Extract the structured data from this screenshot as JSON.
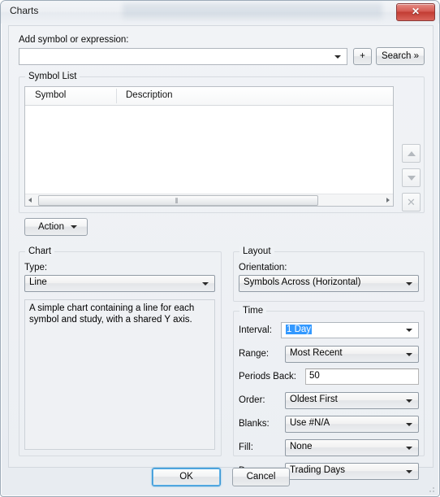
{
  "window": {
    "title": "Charts",
    "close_icon": "close-x-icon"
  },
  "add_symbol": {
    "label": "Add symbol or expression:",
    "input_value": "",
    "input_placeholder": "",
    "dropdown_icon": "chevron-down-icon",
    "add_button_label": "+",
    "search_button_label": "Search »"
  },
  "symbol_list": {
    "caption": "Symbol List",
    "columns": [
      "Symbol",
      "Description"
    ],
    "rows": [],
    "scrollbar": {
      "left_arrow_icon": "arrow-left-icon",
      "right_arrow_icon": "arrow-right-icon",
      "grip_icon": "grip-icon"
    },
    "side_buttons": [
      {
        "name": "move-up-button",
        "icon": "triangle-up-icon",
        "enabled": false
      },
      {
        "name": "move-down-button",
        "icon": "triangle-down-icon",
        "enabled": false
      },
      {
        "name": "remove-button",
        "icon": "x-icon",
        "enabled": false
      }
    ],
    "action_button_label": "Action",
    "action_button_icon": "chevron-down-icon"
  },
  "chart": {
    "caption": "Chart",
    "type_label": "Type:",
    "type_value": "Line",
    "description": "A simple chart containing a line for each symbol and study, with a shared Y axis."
  },
  "layout": {
    "caption": "Layout",
    "orientation_label": "Orientation:",
    "orientation_value": "Symbols Across (Horizontal)"
  },
  "time": {
    "caption": "Time",
    "interval_label": "Interval:",
    "interval_value": "1 Day",
    "interval_selected": true,
    "range_label": "Range:",
    "range_value": "Most Recent",
    "periods_back_label": "Periods Back:",
    "periods_back_value": "50",
    "order_label": "Order:",
    "order_value": "Oldest First",
    "blanks_label": "Blanks:",
    "blanks_value": "Use #N/A",
    "fill_label": "Fill:",
    "fill_value": "None",
    "days_label": "Days:",
    "days_value": "Trading Days"
  },
  "footer": {
    "ok_label": "OK",
    "cancel_label": "Cancel"
  },
  "colors": {
    "selection_blue": "#3399ff",
    "focus_blue": "#3c97d4",
    "close_red": "#c23c33"
  }
}
